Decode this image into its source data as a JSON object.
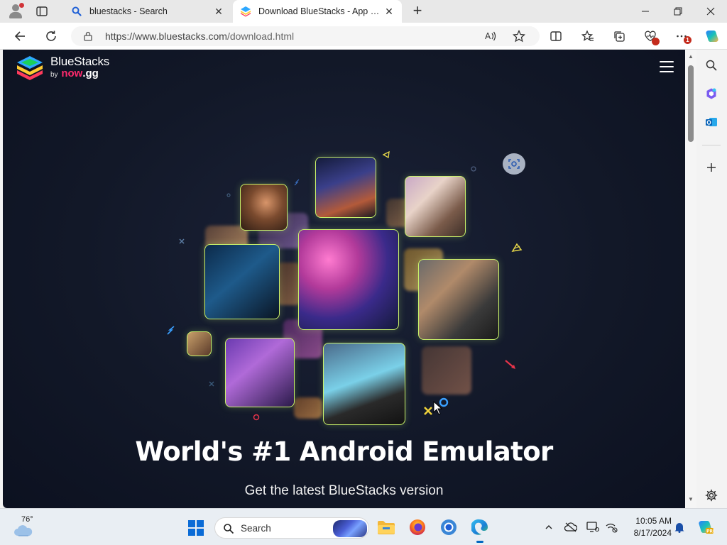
{
  "browser": {
    "tabs": [
      {
        "title": "bluestacks - Search",
        "close": "✕"
      },
      {
        "title": "Download BlueStacks - App Playe",
        "close": "✕"
      }
    ],
    "new_tab": "+",
    "window_controls": {
      "minimize": "—",
      "maximize": "❐",
      "close": "✕"
    },
    "address": {
      "url_host": "https://www.bluestacks.com",
      "url_path": "/download.html"
    },
    "extensions_badge": "1"
  },
  "page": {
    "brand": {
      "name": "BlueStacks",
      "by": "by",
      "now": "now",
      "gg": ".gg"
    },
    "headline": "World's #1 Android Emulator",
    "subline": "Get the latest BlueStacks version"
  },
  "taskbar": {
    "weather_temp": "76°",
    "search_label": "Search",
    "time": "10:05 AM",
    "date": "8/17/2024"
  },
  "colors": {
    "page_bg": "#121828",
    "photo_border": "#c9f26a",
    "now_accent": "#ff2a6d",
    "edge_accent": "#0067c0"
  },
  "icons": [
    "profile-icon",
    "tab-actions-icon",
    "search-icon",
    "bluestacks-icon",
    "back-icon",
    "refresh-icon",
    "lock-icon",
    "read-aloud-icon",
    "favorite-star-icon",
    "split-screen-icon",
    "favorites-icon",
    "collections-icon",
    "browser-essentials-icon",
    "more-icon",
    "copilot-icon",
    "hamburger-menu-icon",
    "office-icon",
    "outlook-icon",
    "add-icon",
    "settings-gear-icon",
    "windows-start-icon",
    "file-explorer-icon",
    "firefox-icon",
    "chrome-icon",
    "edge-icon",
    "wifi-icon",
    "volume-icon",
    "notification-bell-icon"
  ]
}
